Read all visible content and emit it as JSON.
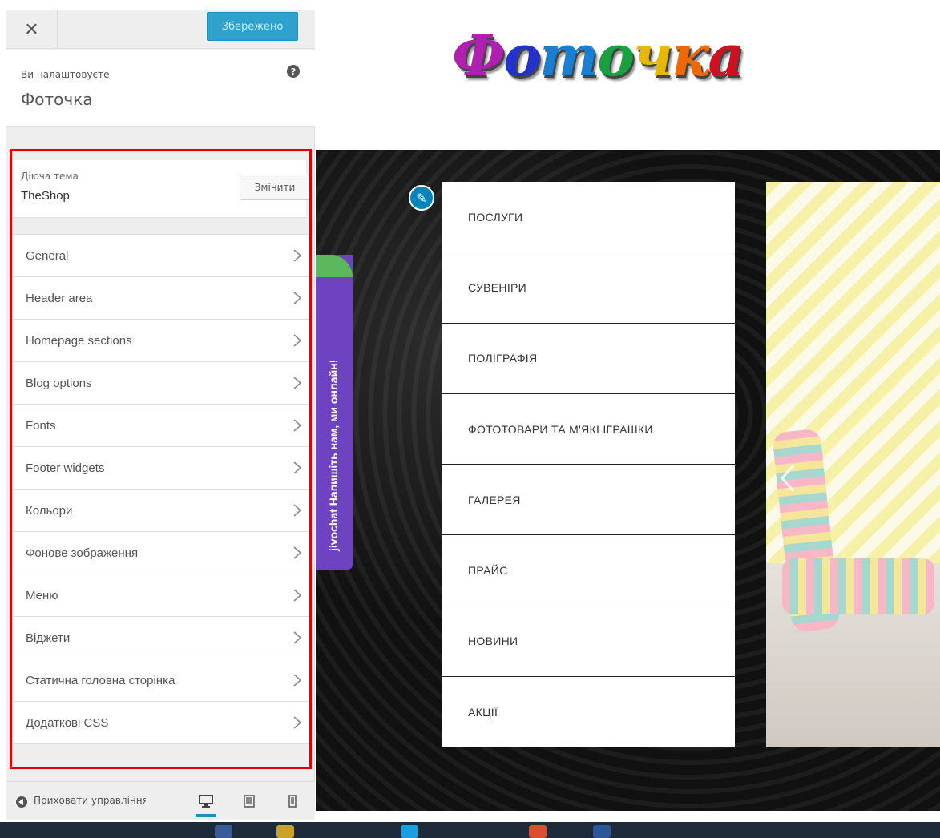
{
  "sidebar": {
    "close_icon": "close-icon",
    "save_label": "Збережено",
    "customizing_label": "Ви налаштовуєте",
    "site_name": "Фоточка",
    "help_icon": "question-icon",
    "active_theme": {
      "label": "Діюча тема",
      "name": "TheShop",
      "change_label": "Змінити"
    },
    "items": [
      {
        "label": "General"
      },
      {
        "label": "Header area"
      },
      {
        "label": "Homepage sections"
      },
      {
        "label": "Blog options"
      },
      {
        "label": "Fonts"
      },
      {
        "label": "Footer widgets"
      },
      {
        "label": "Кольори"
      },
      {
        "label": "Фонове зображення"
      },
      {
        "label": "Меню"
      },
      {
        "label": "Віджети"
      },
      {
        "label": "Статична головна сторінка"
      },
      {
        "label": "Додаткові CSS"
      }
    ],
    "footer": {
      "collapse_label": "Приховати управління",
      "devices": [
        "desktop-icon",
        "tablet-icon",
        "mobile-icon"
      ]
    },
    "colors": {
      "accent": "#2ea2cc",
      "highlight": "#e00000"
    }
  },
  "preview": {
    "logo_letters": [
      "Ф",
      "о",
      "т",
      "о",
      "ч",
      "к",
      "а"
    ],
    "logo_colors": [
      "#b020b0",
      "#2233cc",
      "#1a7fd0",
      "#1aa040",
      "#e6b800",
      "#ee6a00",
      "#d01020"
    ],
    "nav": [
      "ПОСЛУГИ",
      "СУВЕНІРИ",
      "ПОЛІГРАФІЯ",
      "ФОТОТОВАРИ ТА М'ЯКІ ІГРАШКИ",
      "ГАЛЕРЕЯ",
      "ПРАЙС",
      "НОВИНИ",
      "АКЦІЇ"
    ],
    "chat": {
      "brand": "jivochat",
      "text": "Напишіть нам, ми онлайн!"
    }
  }
}
